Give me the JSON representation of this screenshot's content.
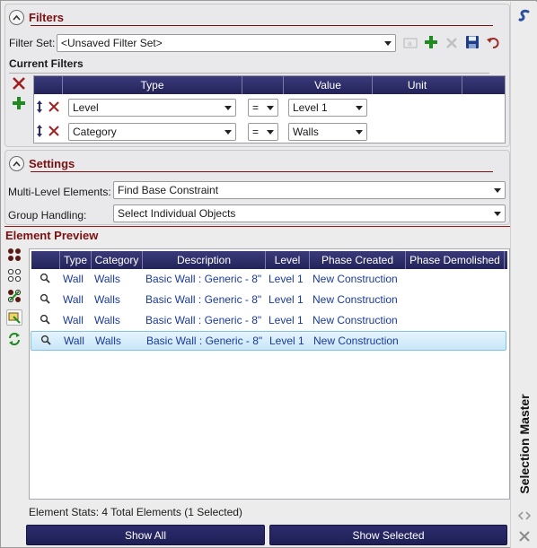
{
  "filters": {
    "title": "Filters",
    "filter_set_label": "Filter Set:",
    "filter_set_value": "<Unsaved Filter Set>",
    "current_filters_label": "Current Filters",
    "columns": [
      "Type",
      "Value",
      "Unit"
    ],
    "rows": [
      {
        "type": "Level",
        "operator": "=",
        "value": "Level 1"
      },
      {
        "type": "Category",
        "operator": "=",
        "value": "Walls"
      }
    ]
  },
  "settings": {
    "title": "Settings",
    "multi_level_label": "Multi-Level Elements:",
    "multi_level_value": "Find Base Constraint",
    "group_label": "Group Handling:",
    "group_value": "Select Individual Objects"
  },
  "preview": {
    "title": "Element Preview",
    "columns": [
      "Type",
      "Category",
      "Description",
      "Level",
      "Phase Created",
      "Phase Demolished"
    ],
    "rows": [
      {
        "type": "Wall",
        "category": "Walls",
        "description": "Basic Wall : Generic - 8\"",
        "level": "Level 1",
        "phase_created": "New Construction",
        "phase_demolished": "",
        "selected": false
      },
      {
        "type": "Wall",
        "category": "Walls",
        "description": "Basic Wall : Generic - 8\"",
        "level": "Level 1",
        "phase_created": "New Construction",
        "phase_demolished": "",
        "selected": false
      },
      {
        "type": "Wall",
        "category": "Walls",
        "description": "Basic Wall : Generic - 8\"",
        "level": "Level 1",
        "phase_created": "New Construction",
        "phase_demolished": "",
        "selected": false
      },
      {
        "type": "Wall",
        "category": "Walls",
        "description": "Basic Wall : Generic - 8\"",
        "level": "Level 1",
        "phase_created": "New Construction",
        "phase_demolished": "",
        "selected": true
      }
    ],
    "stats_label": "Element Stats:",
    "stats_value": "4 Total Elements (1 Selected)",
    "show_all": "Show All",
    "show_selected": "Show Selected"
  },
  "sidebar": {
    "title": "Selection Master"
  },
  "colors": {
    "accent": "#7a1010",
    "header_bg": "#23235a",
    "row_text": "#1a3a9a",
    "selected_row": "#c8e6f8"
  }
}
